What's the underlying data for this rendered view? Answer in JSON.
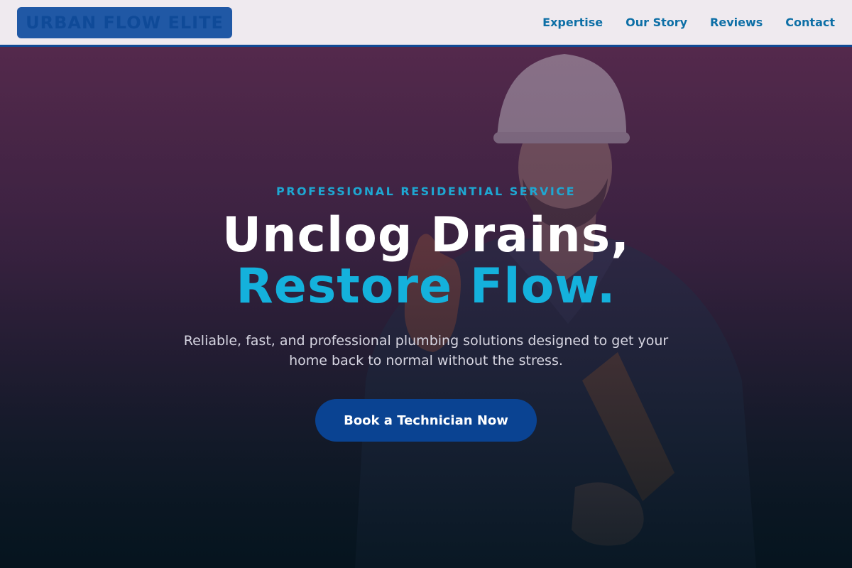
{
  "header": {
    "logo_text": "URBAN FLOW ELITE",
    "nav": [
      {
        "label": "Expertise"
      },
      {
        "label": "Our Story"
      },
      {
        "label": "Reviews"
      },
      {
        "label": "Contact"
      }
    ]
  },
  "hero": {
    "eyebrow": "PROFESSIONAL RESIDENTIAL SERVICE",
    "headline_line1": "Unclog Drains,",
    "headline_line2": "Restore Flow.",
    "subtext": "Reliable, fast, and professional plumbing solutions designed to get your home back to normal without the stress.",
    "cta_label": "Book a Technician Now"
  },
  "colors": {
    "nav_background": "#efeaef",
    "logo_background": "#2058a5",
    "nav_link": "#0d6fa6",
    "accent": "#14b1dc",
    "cta_background": "#0a4392"
  }
}
